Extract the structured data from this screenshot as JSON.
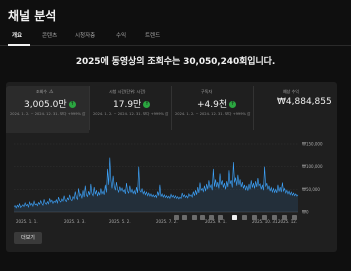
{
  "page": {
    "title": "채널 분석"
  },
  "tabs": [
    {
      "label": "개요",
      "active": true
    },
    {
      "label": "콘텐츠",
      "active": false
    },
    {
      "label": "시청자층",
      "active": false
    },
    {
      "label": "수익",
      "active": false
    },
    {
      "label": "트렌드",
      "active": false
    }
  ],
  "headline": "2025에 동영상의 조회수는 30,050,240회입니다.",
  "metrics": [
    {
      "label": "조회수",
      "value": "3,005.0만",
      "range": "2024. 1. 2. ~ 2024. 12. 31. 보다 +999% 감",
      "icon": "warning-icon",
      "badge": "up-arrow-icon"
    },
    {
      "label": "시청 시간(단위: 시간)",
      "value": "17.9만",
      "range": "2024. 1. 2. ~ 2024. 12. 31. 보다 +999% 감",
      "badge": "up-arrow-icon"
    },
    {
      "label": "구독자",
      "value": "+4.9천",
      "range": "2024. 1. 2. ~ 2024. 12. 31. 보다 +999% 감",
      "badge": "up-arrow-icon"
    },
    {
      "label": "예상 수익",
      "value": "₩4,884,855",
      "range": ""
    }
  ],
  "chart_data": {
    "type": "line",
    "x": [
      "2025. 1. 1.",
      "2025. 3. 3.",
      "2025. 5. 2.",
      "2025. 7. 2.",
      "2025. 9. 1.",
      "2025. 10. 31.",
      "2025. 12."
    ],
    "yticks": [
      "₩150,000",
      "₩100,000",
      "₩50,000",
      "₩0"
    ],
    "ylim": [
      0,
      150000
    ],
    "series": [
      {
        "values": [
          12000,
          14000,
          9000,
          15000,
          11000,
          18000,
          10000,
          13000,
          16000,
          12000,
          20000,
          14000,
          17000,
          11000,
          22000,
          15000,
          19000,
          13000,
          24000,
          16000,
          18000,
          14000,
          21000,
          17000,
          25000,
          19000,
          15000,
          28000,
          20000,
          17000,
          23000,
          18000,
          30000,
          22000,
          26000,
          19000,
          24000,
          21000,
          27000,
          20000,
          33000,
          25000,
          22000,
          29000,
          24000,
          36000,
          26000,
          23000,
          31000,
          27000,
          38000,
          28000,
          25000,
          34000,
          29000,
          45000,
          32000,
          28000,
          52000,
          35000,
          40000,
          30000,
          48000,
          33000,
          58000,
          38000,
          34000,
          46000,
          37000,
          62000,
          41000,
          36000,
          55000,
          39000,
          48000,
          35000,
          44000,
          37000,
          52000,
          40000,
          46000,
          38000,
          60000,
          43000,
          95000,
          60000,
          120000,
          70000,
          52000,
          80000,
          58000,
          48000,
          66000,
          50000,
          44000,
          56000,
          47000,
          53000,
          45000,
          49000,
          40000,
          64000,
          46000,
          42000,
          58000,
          43000,
          50000,
          41000,
          47000,
          39000,
          55000,
          42000,
          100000,
          48000,
          44000,
          52000,
          40000,
          46000,
          38000,
          44000,
          36000,
          42000,
          35000,
          40000,
          34000,
          38000,
          33000,
          37000,
          32000,
          45000,
          36000,
          60000,
          34000,
          40000,
          33000,
          38000,
          32000,
          36000,
          31000,
          35000,
          30000,
          39000,
          33000,
          37000,
          31000,
          36000,
          30000,
          34000,
          29000,
          33000,
          30000,
          42000,
          34000,
          38000,
          32000,
          36000,
          31000,
          40000,
          35000,
          38000,
          33000,
          45000,
          36000,
          48000,
          38000,
          55000,
          42000,
          65000,
          48000,
          52000,
          45000,
          58000,
          46000,
          62000,
          50000,
          70000,
          54000,
          60000,
          48000,
          95000,
          56000,
          72000,
          55000,
          66000,
          52000,
          85000,
          60000,
          70000,
          54000,
          64000,
          50000,
          68000,
          55000,
          92000,
          62000,
          70000,
          54000,
          110000,
          65000,
          76000,
          58000,
          82000,
          60000,
          72000,
          55000,
          66000,
          52000,
          60000,
          48000,
          58000,
          47000,
          62000,
          50000,
          70000,
          54000,
          64000,
          52000,
          68000,
          55000,
          75000,
          58000,
          62000,
          50000,
          60000,
          48000,
          100000,
          56000,
          64000,
          50000,
          58000,
          46000,
          54000,
          44000,
          52000,
          43000,
          50000,
          42000,
          60000,
          45000,
          55000,
          44000,
          65000,
          46000,
          52000,
          42000,
          48000,
          40000,
          46000,
          38000,
          44000,
          37000,
          42000,
          36000,
          40000,
          35000,
          38000
        ]
      }
    ]
  },
  "more_button": "더보기"
}
